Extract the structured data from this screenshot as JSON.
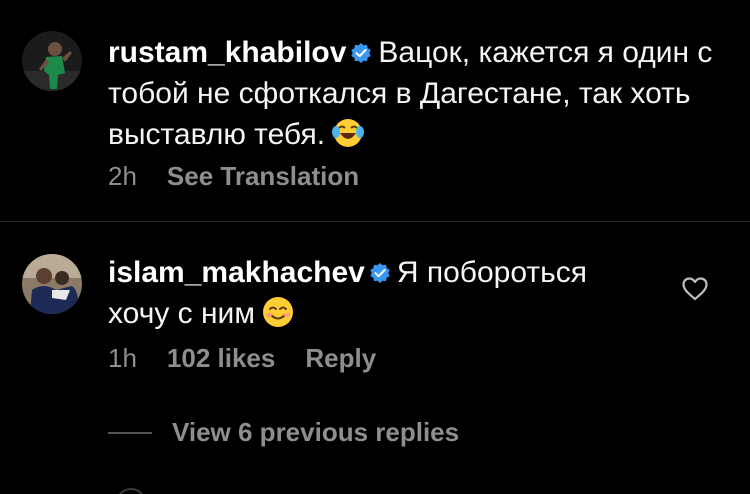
{
  "comments": [
    {
      "username": "rustam_khabilov",
      "text": "Вацок, кажется я один с тобой не сфоткался в Дагестане, так хоть выставлю тебя.",
      "emoji_icon": "face-with-tears-of-joy",
      "time": "2h",
      "action": "See Translation",
      "verified": true
    },
    {
      "username": "islam_makhachev",
      "text": "Я побороться хочу с ним",
      "emoji_icon": "smiling-face-with-smiling-eyes",
      "time": "1h",
      "likes": "102 likes",
      "action": "Reply",
      "verified": true
    }
  ],
  "view_replies_label": "View 6 previous replies",
  "colors": {
    "background": "#000000",
    "text": "#ffffff",
    "muted": "#8e8e8e",
    "verified_badge": "#3897f0"
  }
}
